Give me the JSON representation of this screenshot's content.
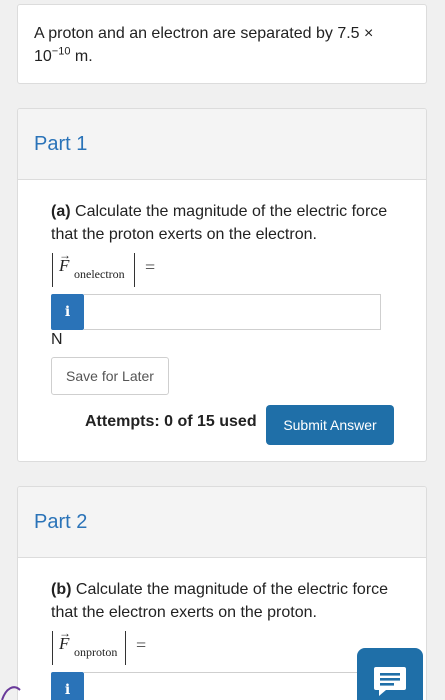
{
  "intro": {
    "text_before": "A proton and an electron are separated by 7.5 × 10",
    "exponent": "−10",
    "text_after": " m."
  },
  "parts": [
    {
      "title": "Part 1",
      "question_label": "(a)",
      "question_text": " Calculate the magnitude of the electric force that the proton exerts on the electron.",
      "math_symbol": "F",
      "math_arrow": "→",
      "math_subscript": "onelectron",
      "math_equals": "=",
      "info_icon": "i",
      "answer_value": "",
      "unit": "N",
      "save_label": "Save for Later",
      "attempts": "Attempts: 0 of 15 used",
      "submit_label": "Submit Answer"
    },
    {
      "title": "Part 2",
      "question_label": "(b)",
      "question_text": " Calculate the magnitude of the electric force that the electron exerts on the proton.",
      "math_symbol": "F",
      "math_arrow": "→",
      "math_subscript": "onproton",
      "math_equals": "=",
      "info_icon": "i",
      "answer_value": ""
    }
  ],
  "chat": {
    "icon": "chat-bubble-icon"
  },
  "colors": {
    "accent": "#2a73b8",
    "button": "#1f6fa8"
  }
}
